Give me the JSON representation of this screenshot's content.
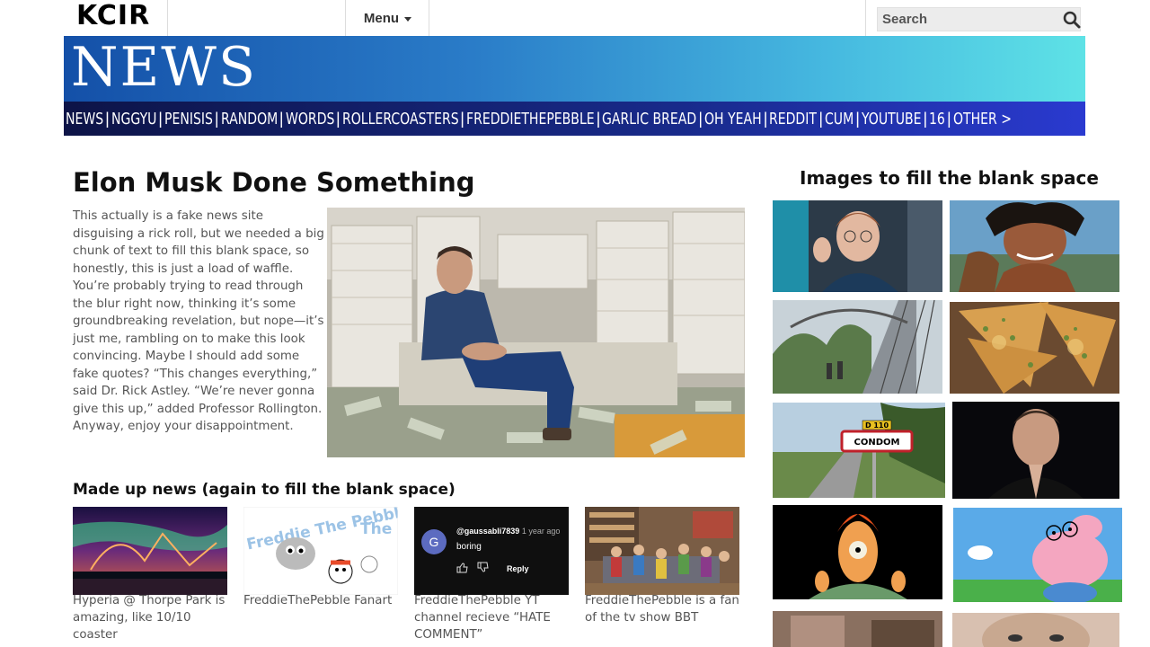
{
  "header": {
    "logo": "KCIR",
    "menu_label": "Menu",
    "search_placeholder": "Search"
  },
  "banner": {
    "brand": "NEWS"
  },
  "nav": {
    "items": [
      "NEWS",
      "NGGYU",
      "PENISIS",
      "RANDOM",
      "WORDS",
      "ROLLERCOASTERS",
      "FREDDIETHEPEBBLE",
      "GARLIC BREAD",
      "OH YEAH",
      "REDDIT",
      "CUM",
      "YOUTUBE",
      "16",
      "OTHER >"
    ]
  },
  "article": {
    "headline": "Elon Musk Done Something",
    "body": "This actually is a fake news site disguising a rick roll, but we needed a big chunk of text to fill this blank space, so honestly, this is just a load of waffle. You’re probably trying to read through the blur right now, thinking it’s some groundbreaking revelation, but nope—it’s just me, rambling on to make this look convincing. Maybe I should add some fake quotes? “This changes everything,” said Dr. Rick Astley. “We’re never gonna give this up,” added Professor Rollington. Anyway, enjoy your disappointment."
  },
  "made_up_news": {
    "title": "Made up news (again to fill the blank space)",
    "cards": [
      {
        "caption": "Hyperia @ Thorpe Park is amazing, like 10/10 coaster"
      },
      {
        "caption": "FreddieThePebble Fanart",
        "art_text": "Freddie The Pebble!",
        "art_text2": "The"
      },
      {
        "caption": "FreddieThePebble YT channel recieve “HATE COMMENT”",
        "comment_user": "@gaussabli7839",
        "comment_time": "1 year ago",
        "comment_text": "boring",
        "reply_label": "Reply",
        "avatar_letter": "G"
      },
      {
        "caption": "FreddieThePebble is a fan of the tv show BBT"
      }
    ]
  },
  "sidebar": {
    "title": "Images to fill the blank space",
    "sign_number": "D 110",
    "sign_text": "CONDOM"
  },
  "colors": {
    "nav_start": "#0d1447",
    "banner_end": "#5ee2e6"
  }
}
